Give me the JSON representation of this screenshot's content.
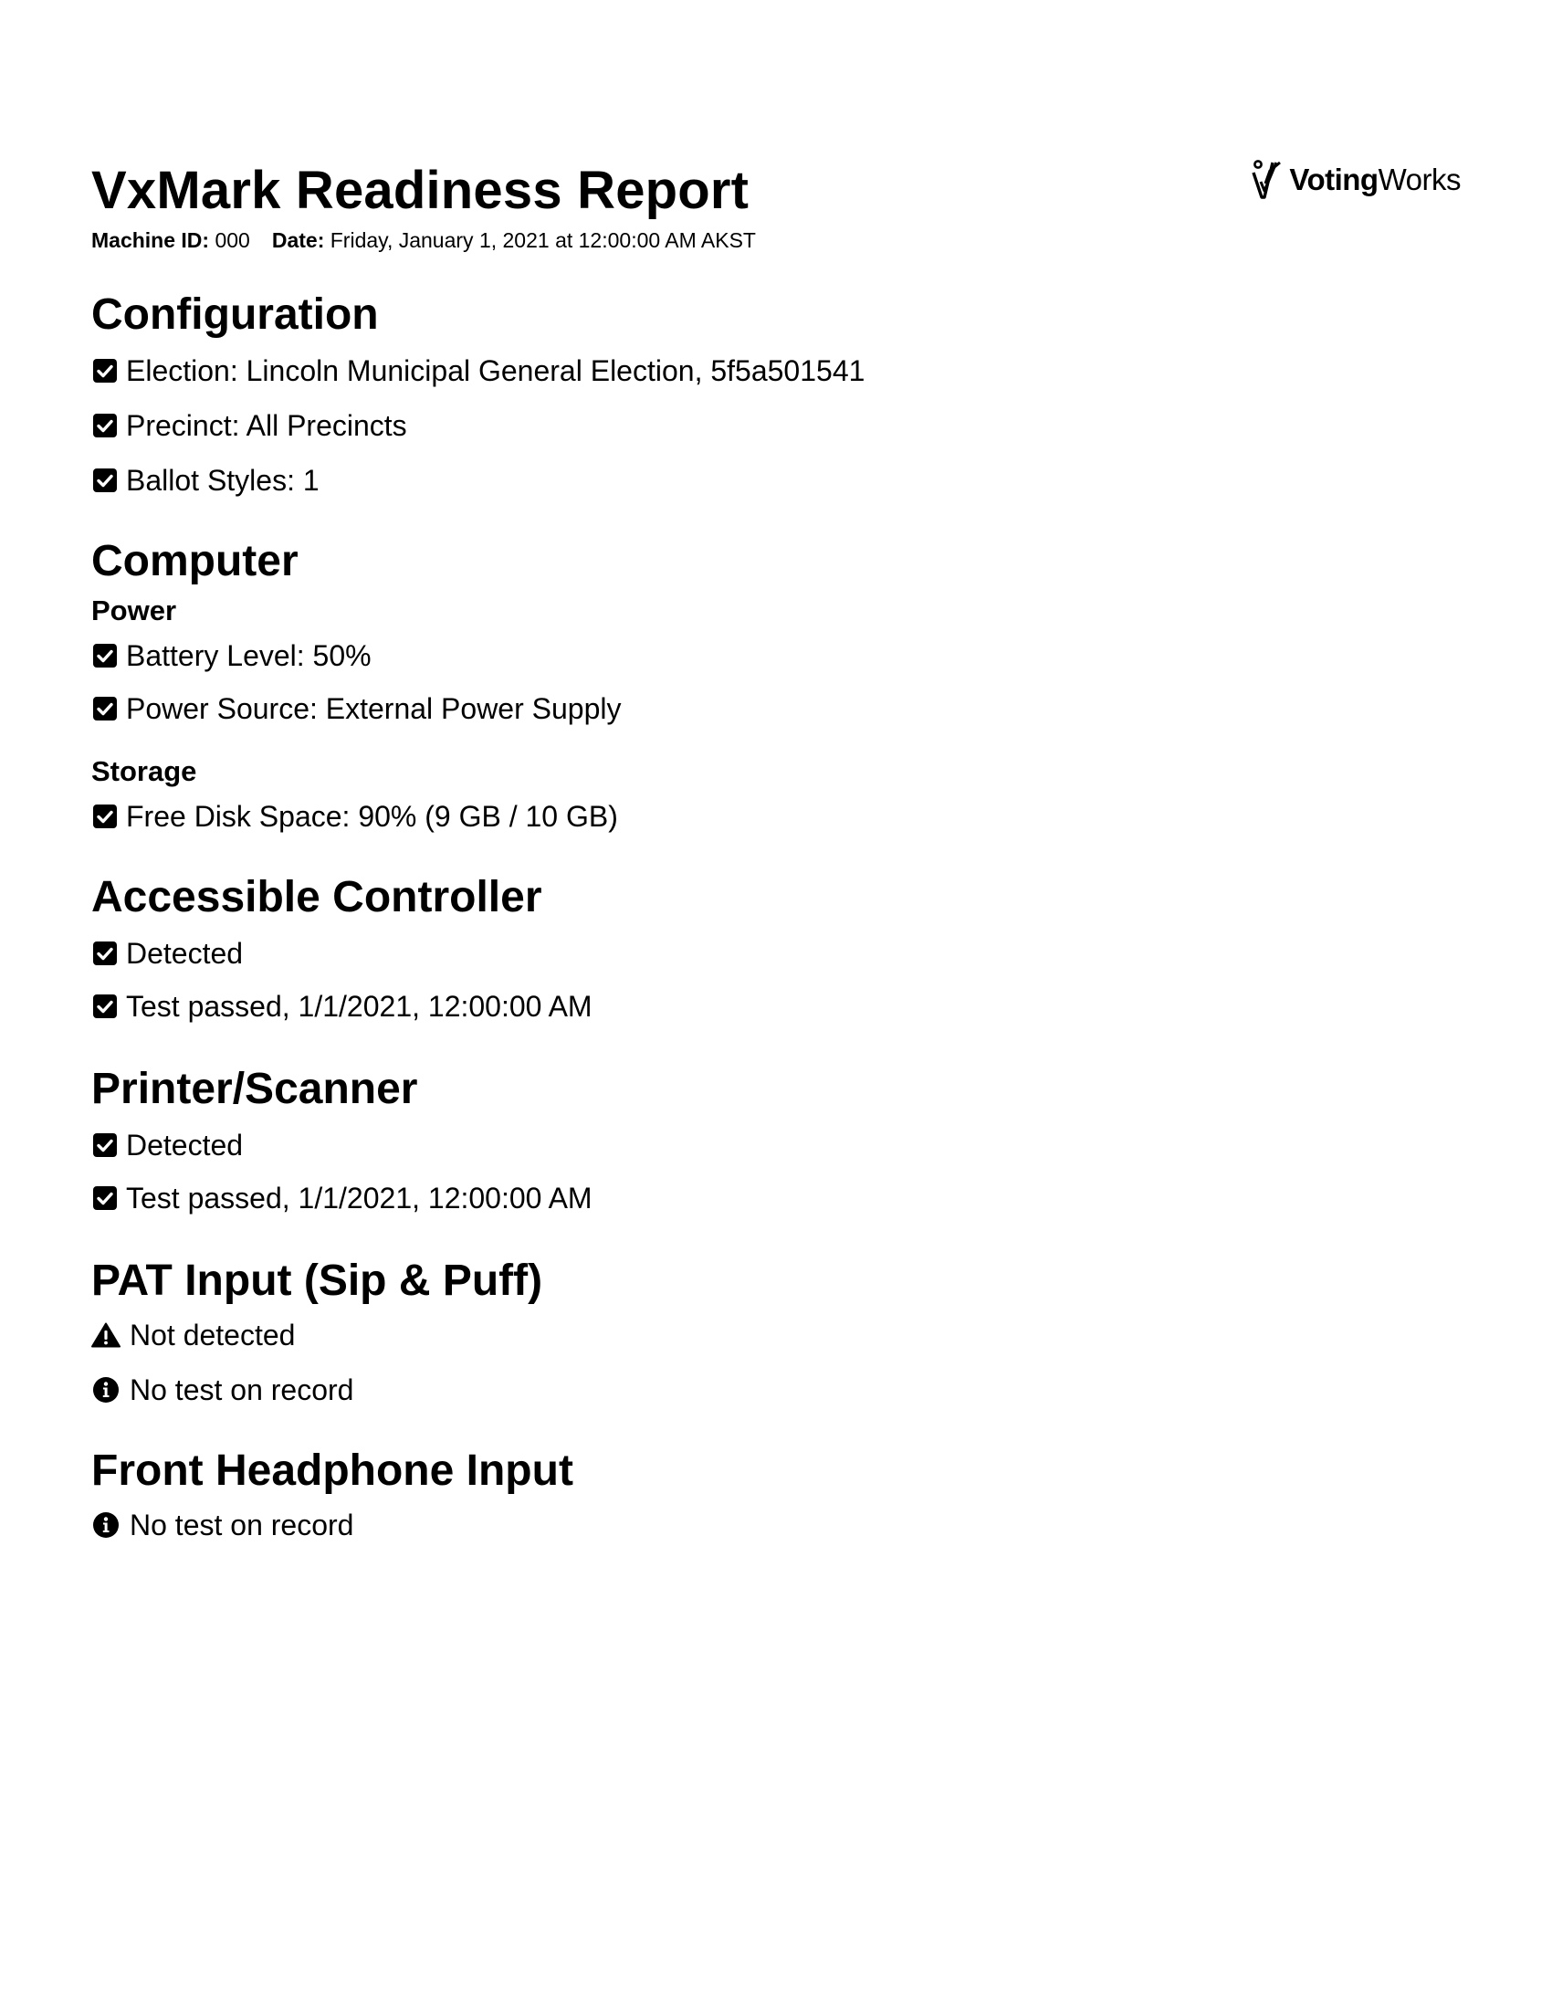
{
  "header": {
    "title": "VxMark Readiness Report",
    "machine_id_label": "Machine ID:",
    "machine_id": "000",
    "date_label": "Date:",
    "date": "Friday, January 1, 2021 at 12:00:00 AM AKST"
  },
  "logo": {
    "icon": "votingworks-checkmark-logo",
    "bold": "Voting",
    "regular": "Works"
  },
  "sections": {
    "configuration": {
      "title": "Configuration",
      "items": [
        {
          "text": "Election: Lincoln Municipal General Election, 5f5a501541",
          "icon": "check-square-icon"
        },
        {
          "text": "Precinct: All Precincts",
          "icon": "check-square-icon"
        },
        {
          "text": "Ballot Styles: 1",
          "icon": "check-square-icon"
        }
      ]
    },
    "computer": {
      "title": "Computer",
      "power": {
        "title": "Power",
        "items": [
          {
            "text": "Battery Level: 50%",
            "icon": "check-square-icon"
          },
          {
            "text": "Power Source: External Power Supply",
            "icon": "check-square-icon"
          }
        ]
      },
      "storage": {
        "title": "Storage",
        "items": [
          {
            "text": "Free Disk Space: 90% (9 GB / 10 GB)",
            "icon": "check-square-icon"
          }
        ]
      }
    },
    "accessible_controller": {
      "title": "Accessible Controller",
      "items": [
        {
          "text": "Detected",
          "icon": "check-square-icon"
        },
        {
          "text": "Test passed, 1/1/2021, 12:00:00 AM",
          "icon": "check-square-icon"
        }
      ]
    },
    "printer_scanner": {
      "title": "Printer/Scanner",
      "items": [
        {
          "text": "Detected",
          "icon": "check-square-icon"
        },
        {
          "text": "Test passed, 1/1/2021, 12:00:00 AM",
          "icon": "check-square-icon"
        }
      ]
    },
    "pat_input": {
      "title": "PAT Input (Sip & Puff)",
      "items": [
        {
          "text": "Not detected",
          "icon": "warning-triangle-icon"
        },
        {
          "text": "No test on record",
          "icon": "info-circle-icon"
        }
      ]
    },
    "headphone_input": {
      "title": "Front Headphone Input",
      "items": [
        {
          "text": "No test on record",
          "icon": "info-circle-icon"
        }
      ]
    }
  }
}
